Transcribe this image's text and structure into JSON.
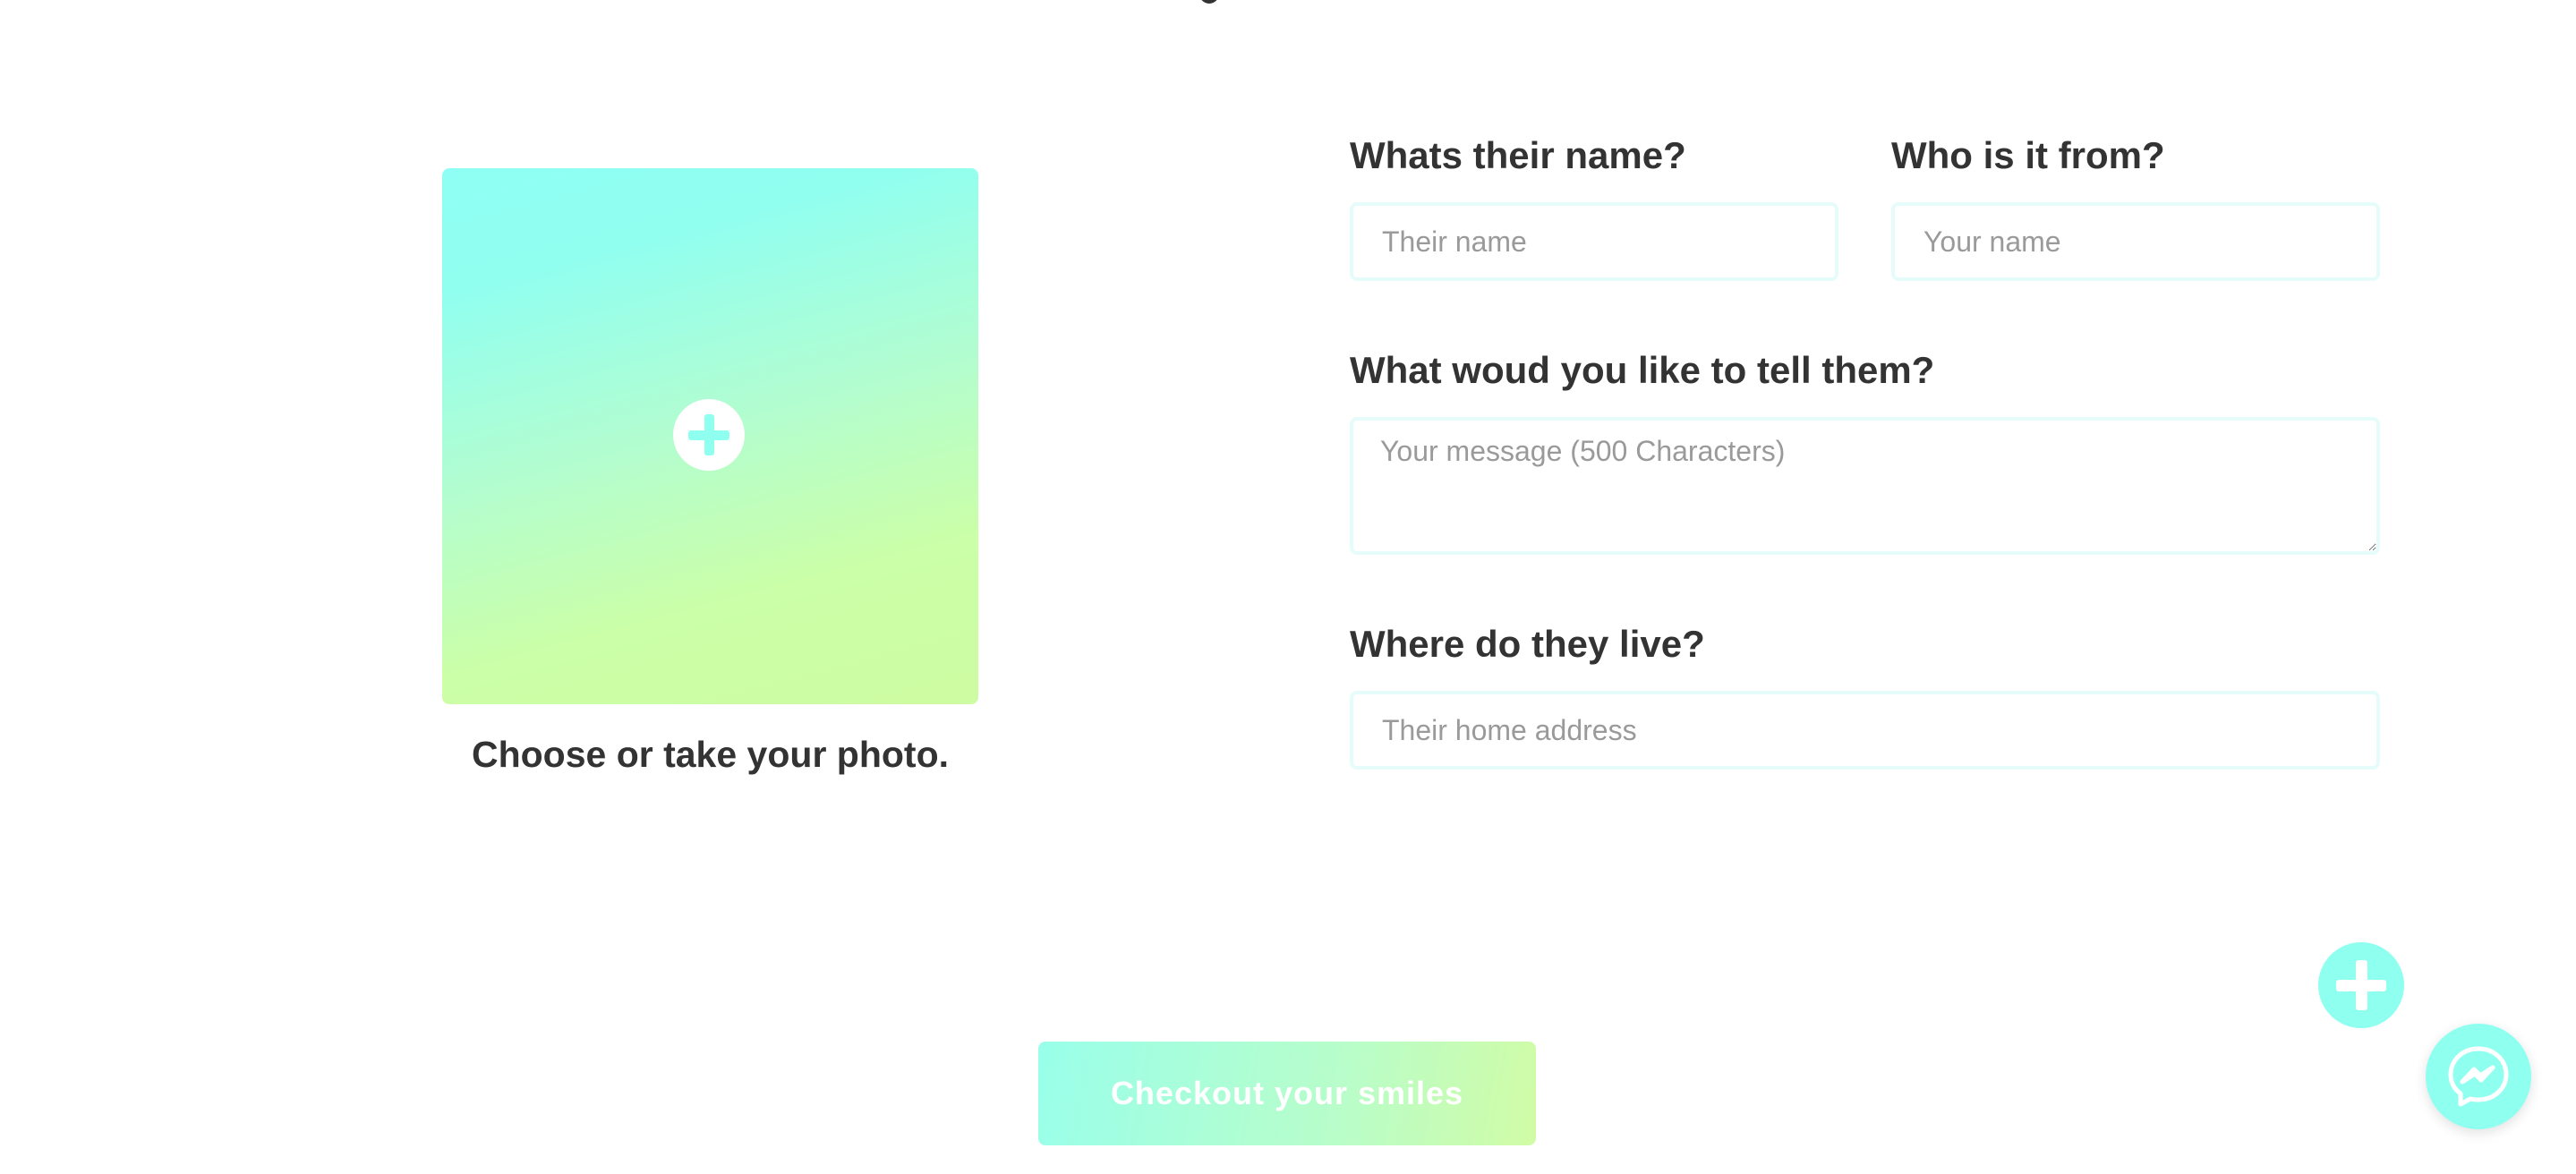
{
  "photo": {
    "caption": "Choose or take your photo.",
    "icon": "plus-circle-icon"
  },
  "form": {
    "their_name": {
      "label": "Whats their name?",
      "placeholder": "Their name",
      "value": ""
    },
    "from_name": {
      "label": "Who is it from?",
      "placeholder": "Your name",
      "value": ""
    },
    "message": {
      "label": "What woud you like to tell them?",
      "placeholder": "Your message (500 Characters)",
      "value": ""
    },
    "address": {
      "label": "Where do they live?",
      "placeholder": "Their home address",
      "value": ""
    }
  },
  "checkout": {
    "label": "Checkout your smiles"
  },
  "fab": {
    "icon": "plus-icon"
  },
  "chat": {
    "icon": "messenger-icon"
  },
  "colors": {
    "accent": "#8ffff0",
    "gradient_start": "#8ffff5",
    "gradient_end": "#cdfca2",
    "text": "#333333",
    "field_border": "#e6fcfb"
  }
}
